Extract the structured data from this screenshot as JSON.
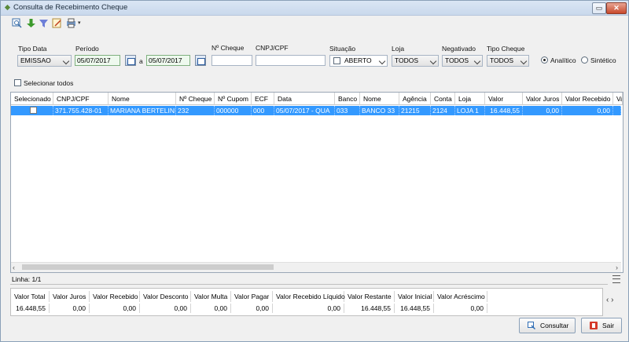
{
  "window": {
    "title": "Consulta de Recebimento Cheque",
    "min_glyph": "▭",
    "close_glyph": "✕"
  },
  "toolbar": {
    "icons": [
      "search-icon",
      "arrow-down-icon",
      "filter-icon",
      "edit-icon",
      "print-icon"
    ]
  },
  "filters": {
    "tipo_data": {
      "label": "Tipo Data",
      "value": "EMISSAO"
    },
    "periodo": {
      "label": "Período",
      "from": "05/07/2017",
      "sep": "a",
      "to": "05/07/2017"
    },
    "num_cheque": {
      "label": "Nº Cheque",
      "value": ""
    },
    "cnpj": {
      "label": "CNPJ/CPF",
      "value": ""
    },
    "situacao": {
      "label": "Situação",
      "value": "ABERTO"
    },
    "loja": {
      "label": "Loja",
      "value": "TODOS"
    },
    "negativado": {
      "label": "Negativado",
      "value": "TODOS"
    },
    "tipo_cheque": {
      "label": "Tipo Cheque",
      "value": "TODOS"
    },
    "mode": {
      "analitico": "Analítico",
      "sintetico": "Sintético"
    },
    "selecionar_todos": "Selecionar todos"
  },
  "grid": {
    "columns": [
      "Selecionado",
      "CNPJ/CPF",
      "Nome",
      "Nº Cheque",
      "Nº Cupom",
      "ECF",
      "Data",
      "Banco",
      "Nome",
      "Agência",
      "Conta",
      "Loja",
      "Valor",
      "Valor Juros",
      "Valor Recebido",
      "Va"
    ],
    "rows": [
      [
        "",
        "371.755.428-01",
        "MARIANA BERTELINI",
        "232",
        "000000",
        "000",
        "05/07/2017 - QUA",
        "033",
        "BANCO 33",
        "21215",
        "2124",
        "LOJA 1",
        "16.448,55",
        "0,00",
        "0,00",
        ""
      ]
    ]
  },
  "status": {
    "linha": "Linha: 1/1"
  },
  "totals": {
    "headers": [
      "Valor Total",
      "Valor Juros",
      "Valor Recebido",
      "Valor Desconto",
      "Valor Multa",
      "Valor Pagar",
      "Valor Recebido Líquido",
      "Valor Restante",
      "Valor Inicial",
      "Valor Acréscimo"
    ],
    "values": [
      "16.448,55",
      "0,00",
      "0,00",
      "0,00",
      "0,00",
      "0,00",
      "0,00",
      "16.448,55",
      "16.448,55",
      "0,00"
    ]
  },
  "buttons": {
    "consultar": "Consultar",
    "sair": "Sair"
  },
  "colors": {
    "selection": "#3399ff",
    "titlebar": "#c9d8ec"
  }
}
